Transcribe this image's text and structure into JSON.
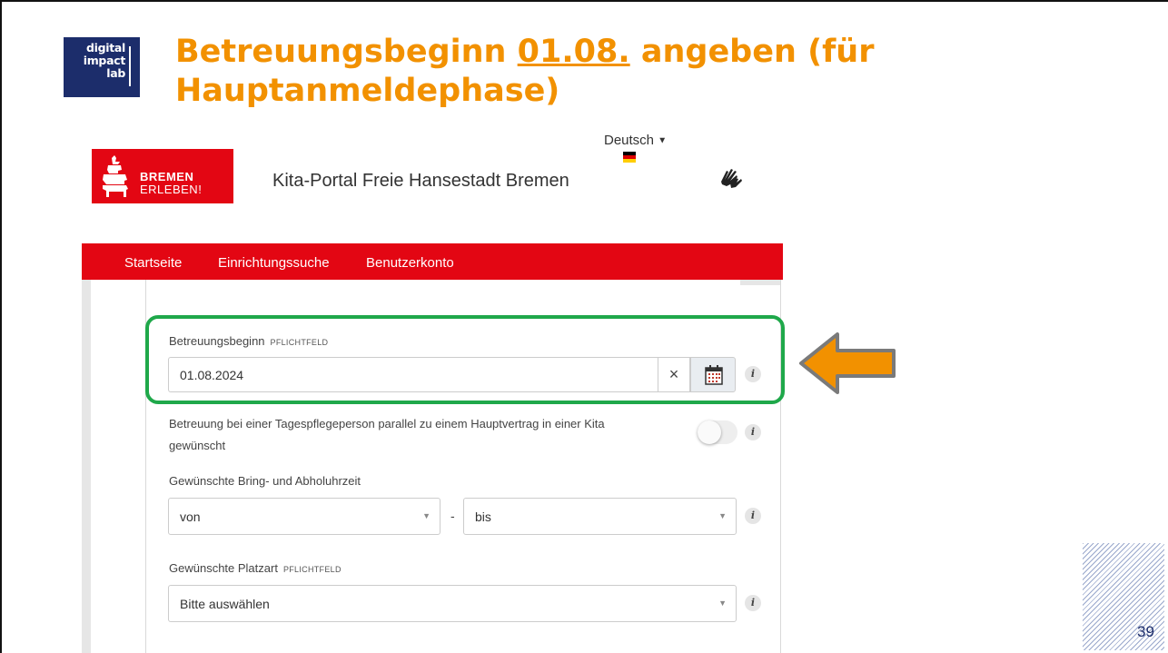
{
  "slide": {
    "title_part1": "Betreuungsbeginn ",
    "title_date": "01.08.",
    "title_part2": " angeben (für",
    "title_line2": "Hauptanmeldephase)",
    "page_number": "39",
    "title_color": "#f29100"
  },
  "logo": {
    "line1": "digital",
    "line2": "impact",
    "line3": "lab",
    "color": "#1c2d6b"
  },
  "portal": {
    "brand_line1": "BREMEN",
    "brand_line2": "ERLEBEN!",
    "brand_color": "#e30613",
    "name": "Kita-Portal Freie Hansestadt Bremen",
    "language": "Deutsch",
    "sign_language_icon": "sign-language-icon"
  },
  "nav": {
    "items": [
      {
        "label": "Startseite"
      },
      {
        "label": "Einrichtungssuche"
      },
      {
        "label": "Benutzerkonto"
      }
    ]
  },
  "form": {
    "betreuungsbeginn": {
      "label": "Betreuungsbeginn",
      "required": "PFLICHTFELD",
      "value": "01.08.2024",
      "clear": "×"
    },
    "tagespflege": {
      "label_line1": "Betreuung bei einer Tagespflegeperson parallel zu einem Hauptvertrag in einer Kita",
      "label_line2": "gewünscht",
      "toggle_on": false
    },
    "uhrzeit": {
      "label": "Gewünschte Bring- und Abholuhrzeit",
      "from_placeholder": "von",
      "separator": "-",
      "to_placeholder": "bis"
    },
    "platzart": {
      "label": "Gewünschte Platzart",
      "required": "PFLICHTFELD",
      "value": "Bitte auswählen"
    },
    "info_glyph": "i",
    "highlight_color": "#1fa84a",
    "arrow_color": "#f29100"
  }
}
